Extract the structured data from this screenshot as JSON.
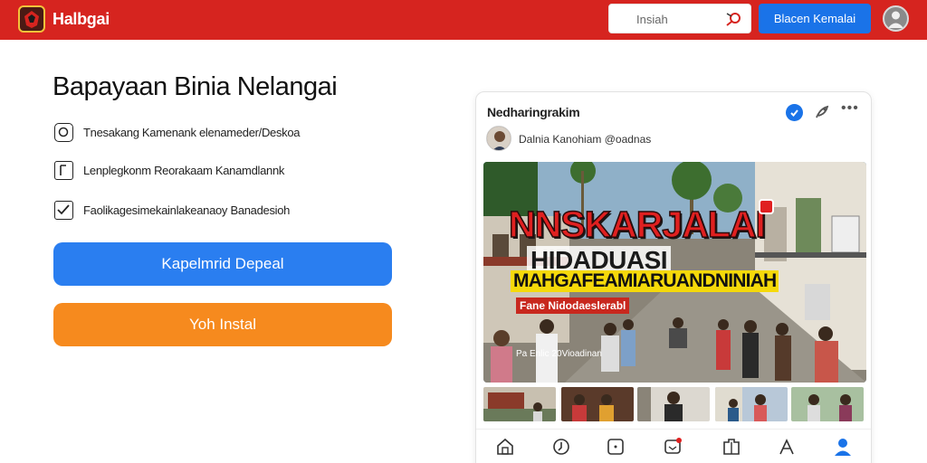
{
  "header": {
    "brand": "Halbgai",
    "search_placeholder": "Insiah",
    "signin_label": "Blacen Kemalai",
    "colors": {
      "topbar": "#d6241f",
      "signin": "#1a73e8"
    }
  },
  "main": {
    "headline": "Bapayaan Binia Nelangai",
    "features": [
      {
        "icon": "chat-icon",
        "text": "Tnesakang Kamenank elenameder/Deskoa"
      },
      {
        "icon": "frame-icon",
        "text": "Lenplegkonm Reorakaam Kanamdlannk"
      },
      {
        "icon": "checkbox-icon",
        "text": "Faolikagesimekainlakeanaoy Banadesioh"
      }
    ],
    "primary_button": "Kapelmrid Depeal",
    "secondary_button": "Yoh Instal",
    "colors": {
      "primary": "#2a7ef0",
      "secondary": "#f68a1e"
    }
  },
  "card": {
    "title": "Nedharingrakim",
    "poster": "Dalnia Kanohiam @oadnas",
    "hero": {
      "line1": "NNSKARJALAI",
      "line2": "HIDADUASI",
      "line3": "MAHGAFEAMIARUANDNINIAH",
      "line4": "Fane Nidodaeslerabl",
      "line5": "Pa Enlic 20Vioadinan"
    },
    "thumbnail_count": 5,
    "nav_icons": [
      "home-icon",
      "compass-icon",
      "square-icon",
      "notification-icon",
      "gift-icon",
      "flag-icon",
      "profile-icon"
    ]
  }
}
